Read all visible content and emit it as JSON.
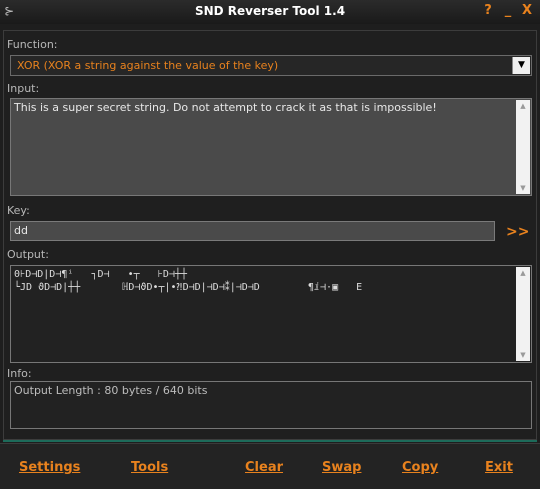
{
  "window": {
    "title": "SND Reverser Tool 1.4",
    "help_label": "?",
    "minimize_label": "_",
    "close_label": "X"
  },
  "function": {
    "label": "Function:",
    "selected": "XOR (XOR a string against the value of the key)"
  },
  "input": {
    "label": "Input:",
    "value": "This is a super secret string. Do not attempt to crack it as that is impossible!"
  },
  "key": {
    "label": "Key:",
    "value": "dd",
    "go_label": ">>"
  },
  "output": {
    "label": "Output:",
    "lines": [
      "0⊦D⊣D|D⊣¶ⁱ   ┐D⊣   •┬   ⊦D⊣┼┼",
      "└JD ϑD⊣D|┼┼       ℍD⊣ϑD•┬|•⁈D⊣D|⊣D⊣⁑|⊣D⊣D        ¶ⅈ⊣·▣   E"
    ]
  },
  "info": {
    "label": "Info:",
    "value": "Output Length : 80 bytes / 640 bits"
  },
  "toolbar": {
    "settings": "Settings",
    "tools": "Tools",
    "clear": "Clear",
    "swap": "Swap",
    "copy": "Copy",
    "exit": "Exit"
  },
  "colors": {
    "accent": "#e8821e",
    "background": "#1e1e1e",
    "field": "#4a4a4a"
  }
}
